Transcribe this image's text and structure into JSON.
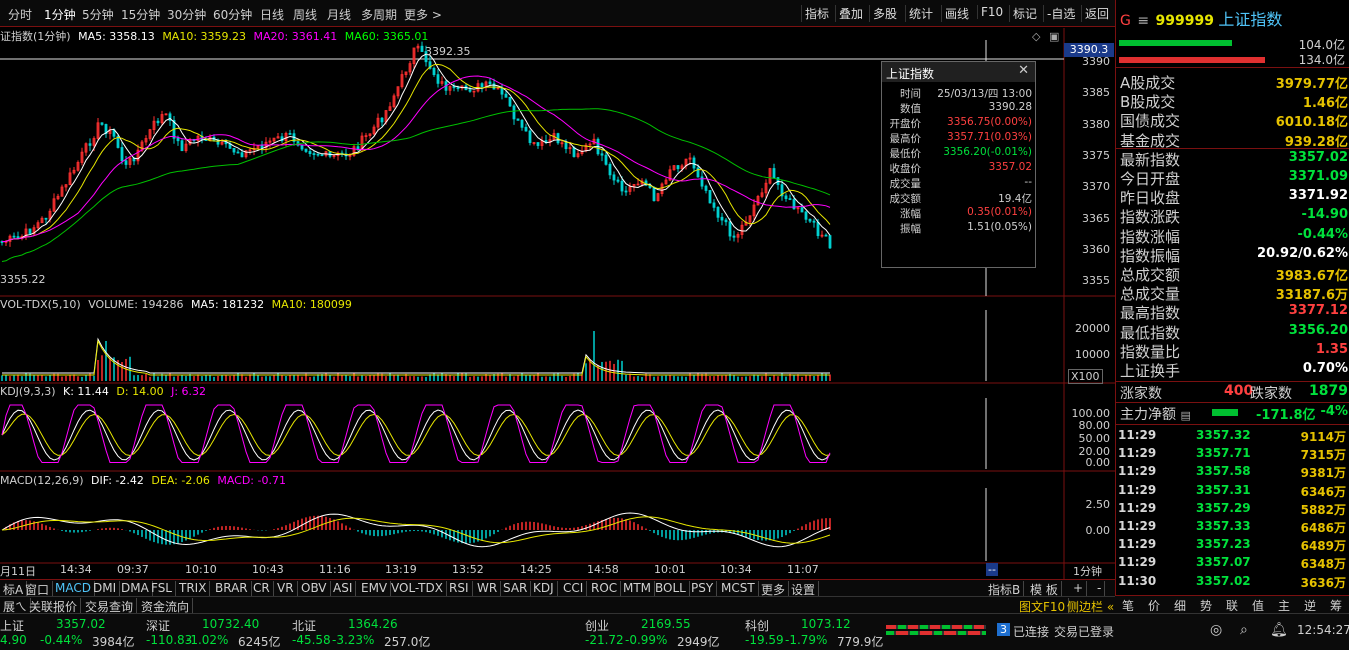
{
  "timeframes": [
    "分时",
    "1分钟",
    "5分钟",
    "15分钟",
    "30分钟",
    "60分钟",
    "日线",
    "周线",
    "月线",
    "多周期",
    "更多 >"
  ],
  "toolbar_right": [
    "指标",
    "叠加",
    "多股",
    "统计",
    "画线",
    "F10",
    "标记",
    "-自选",
    "返回"
  ],
  "main_chart": {
    "title": "证指数(1分钟)",
    "ma5": "MA5: 3358.13",
    "ma10": "MA10: 3359.23",
    "ma20": "MA20: 3361.41",
    "ma60": "MA60: 3365.01",
    "high_label": "3392.35",
    "low_label": "3355.22",
    "cursor_price": "3390.3",
    "price_ticks": [
      "3390",
      "3385",
      "3380",
      "3375",
      "3370",
      "3365",
      "3360",
      "3355"
    ]
  },
  "volume_panel": {
    "name": "VOL-TDX(5,10)",
    "volume": "VOLUME: 194286",
    "ma5": "MA5: 181232",
    "ma10": "MA10: 180099",
    "ticks": [
      "20000",
      "10000"
    ],
    "unit": "X100"
  },
  "kdj_panel": {
    "name": "KDJ(9,3,3)",
    "k": "K: 11.44",
    "d": "D: 14.00",
    "j": "J: 6.32",
    "ticks": [
      "100.00",
      "80.00",
      "50.00",
      "20.00",
      "0.00"
    ]
  },
  "macd_panel": {
    "name": "MACD(12,26,9)",
    "dif": "DIF: -2.42",
    "dea": "DEA: -2.06",
    "macd": "MACD: -0.71",
    "ticks": [
      "2.50",
      "0.00"
    ]
  },
  "time_axis": [
    "月11日",
    "14:34",
    "09:37",
    "10:10",
    "10:43",
    "11:16",
    "14:25",
    "13:19",
    "13:52",
    "14:58",
    "10:01",
    "10:34",
    "11:07"
  ],
  "time_axis_right": "1分钟",
  "cursor_tag": "--",
  "info_box": {
    "title": "上证指数",
    "rows": [
      {
        "k": "时间",
        "v": "25/03/13/四 13:00",
        "c": "#d0d0d0"
      },
      {
        "k": "数值",
        "v": "3390.28",
        "c": "#d0d0d0"
      },
      {
        "k": "开盘价",
        "v": "3356.75(0.00%)",
        "c": "#ff4040"
      },
      {
        "k": "最高价",
        "v": "3357.71(0.03%)",
        "c": "#ff4040"
      },
      {
        "k": "最低价",
        "v": "3356.20(-0.01%)",
        "c": "#00e13c"
      },
      {
        "k": "收盘价",
        "v": "3357.02",
        "c": "#ff4040"
      },
      {
        "k": "成交量",
        "v": "--",
        "c": "#d0d0d0"
      },
      {
        "k": "成交额",
        "v": "19.4亿",
        "c": "#d0d0d0"
      },
      {
        "k": "涨幅",
        "v": "0.35(0.01%)",
        "c": "#ff4040"
      },
      {
        "k": "振幅",
        "v": "1.51(0.05%)",
        "c": "#d0d0d0"
      }
    ]
  },
  "indicator_tabs": [
    "标A",
    "窗口",
    "MACD",
    "DMI",
    "DMA",
    "FSL",
    "TRIX",
    "BRAR",
    "CR",
    "VR",
    "OBV",
    "ASI",
    "EMV",
    "VOL-TDX",
    "RSI",
    "WR",
    "SAR",
    "KDJ",
    "CCI",
    "ROC",
    "MTM",
    "BOLL",
    "PSY",
    "MCST",
    "更多",
    "设置"
  ],
  "indicator_tabs_right": [
    "指标B",
    "模 板",
    "+",
    "-"
  ],
  "subtabs": [
    "展ㄟ",
    "关联报价",
    "交易查询",
    "资金流向"
  ],
  "subtabs_right": [
    "图文F10",
    "侧边栏 «"
  ],
  "stock": {
    "prefix": "G",
    "code": "999999",
    "name": "上证指数",
    "bar1": "104.0亿",
    "bar2": "134.0亿"
  },
  "stats": [
    {
      "label": "A股成交",
      "value": "3979.77亿",
      "color": "#e6c200"
    },
    {
      "label": "B股成交",
      "value": "1.46亿",
      "color": "#e6c200"
    },
    {
      "label": "国债成交",
      "value": "6010.18亿",
      "color": "#e6c200"
    },
    {
      "label": "基金成交",
      "value": "939.28亿",
      "color": "#e6c200"
    },
    {
      "label": "最新指数",
      "value": "3357.02",
      "color": "#00e13c"
    },
    {
      "label": "今日开盘",
      "value": "3371.09",
      "color": "#00e13c"
    },
    {
      "label": "昨日收盘",
      "value": "3371.92",
      "color": "#ffffff"
    },
    {
      "label": "指数涨跌",
      "value": "-14.90",
      "color": "#00e13c"
    },
    {
      "label": "指数涨幅",
      "value": "-0.44%",
      "color": "#00e13c"
    },
    {
      "label": "指数振幅",
      "value": "20.92/0.62%",
      "color": "#ffffff"
    },
    {
      "label": "总成交额",
      "value": "3983.67亿",
      "color": "#e6c200"
    },
    {
      "label": "总成交量",
      "value": "33187.6万",
      "color": "#e6c200"
    },
    {
      "label": "最高指数",
      "value": "3377.12",
      "color": "#ff4040"
    },
    {
      "label": "最低指数",
      "value": "3356.20",
      "color": "#00e13c"
    },
    {
      "label": "指数量比",
      "value": "1.35",
      "color": "#ff4040"
    },
    {
      "label": "上证换手",
      "value": "0.70%",
      "color": "#ffffff"
    }
  ],
  "adv_decl": {
    "up_label": "涨家数",
    "up": "400",
    "down_label": "跌家数",
    "down": "1879"
  },
  "net_flow": {
    "label": "主力净额",
    "value": "-171.8亿",
    "pct": "-4%"
  },
  "ticks": [
    {
      "t": "11:29",
      "p": "3357.32",
      "v": "9114万"
    },
    {
      "t": "11:29",
      "p": "3357.71",
      "v": "7315万"
    },
    {
      "t": "11:29",
      "p": "3357.58",
      "v": "9381万"
    },
    {
      "t": "11:29",
      "p": "3357.31",
      "v": "6346万"
    },
    {
      "t": "11:29",
      "p": "3357.29",
      "v": "5882万"
    },
    {
      "t": "11:29",
      "p": "3357.33",
      "v": "6486万"
    },
    {
      "t": "11:29",
      "p": "3357.23",
      "v": "6489万"
    },
    {
      "t": "11:29",
      "p": "3357.07",
      "v": "6348万"
    },
    {
      "t": "11:30",
      "p": "3357.02",
      "v": "3636万"
    }
  ],
  "right_tabs": [
    "笔",
    "价",
    "细",
    "势",
    "联",
    "值",
    "主",
    "逆",
    "筹"
  ],
  "markets": [
    {
      "name": "上证",
      "price": "3357.02",
      "chg": "4.90",
      "pct": "-0.44%",
      "amt": "3984亿"
    },
    {
      "name": "深证",
      "price": "10732.40",
      "chg": "-110.83",
      "pct": "-1.02%",
      "amt": "6245亿"
    },
    {
      "name": "北证",
      "price": "1364.26",
      "chg": "-45.58",
      "pct": "-3.23%",
      "amt": "257.0亿"
    },
    {
      "name": "创业",
      "price": "2169.55",
      "chg": "-21.72",
      "pct": "-0.99%",
      "amt": "2949亿"
    },
    {
      "name": "科创",
      "price": "1073.12",
      "chg": "-19.59",
      "pct": "-1.79%",
      "amt": "779.9亿"
    }
  ],
  "status": {
    "badge": "3",
    "conn": "已连接",
    "login": "交易已登录",
    "clock": "12:54:27"
  }
}
